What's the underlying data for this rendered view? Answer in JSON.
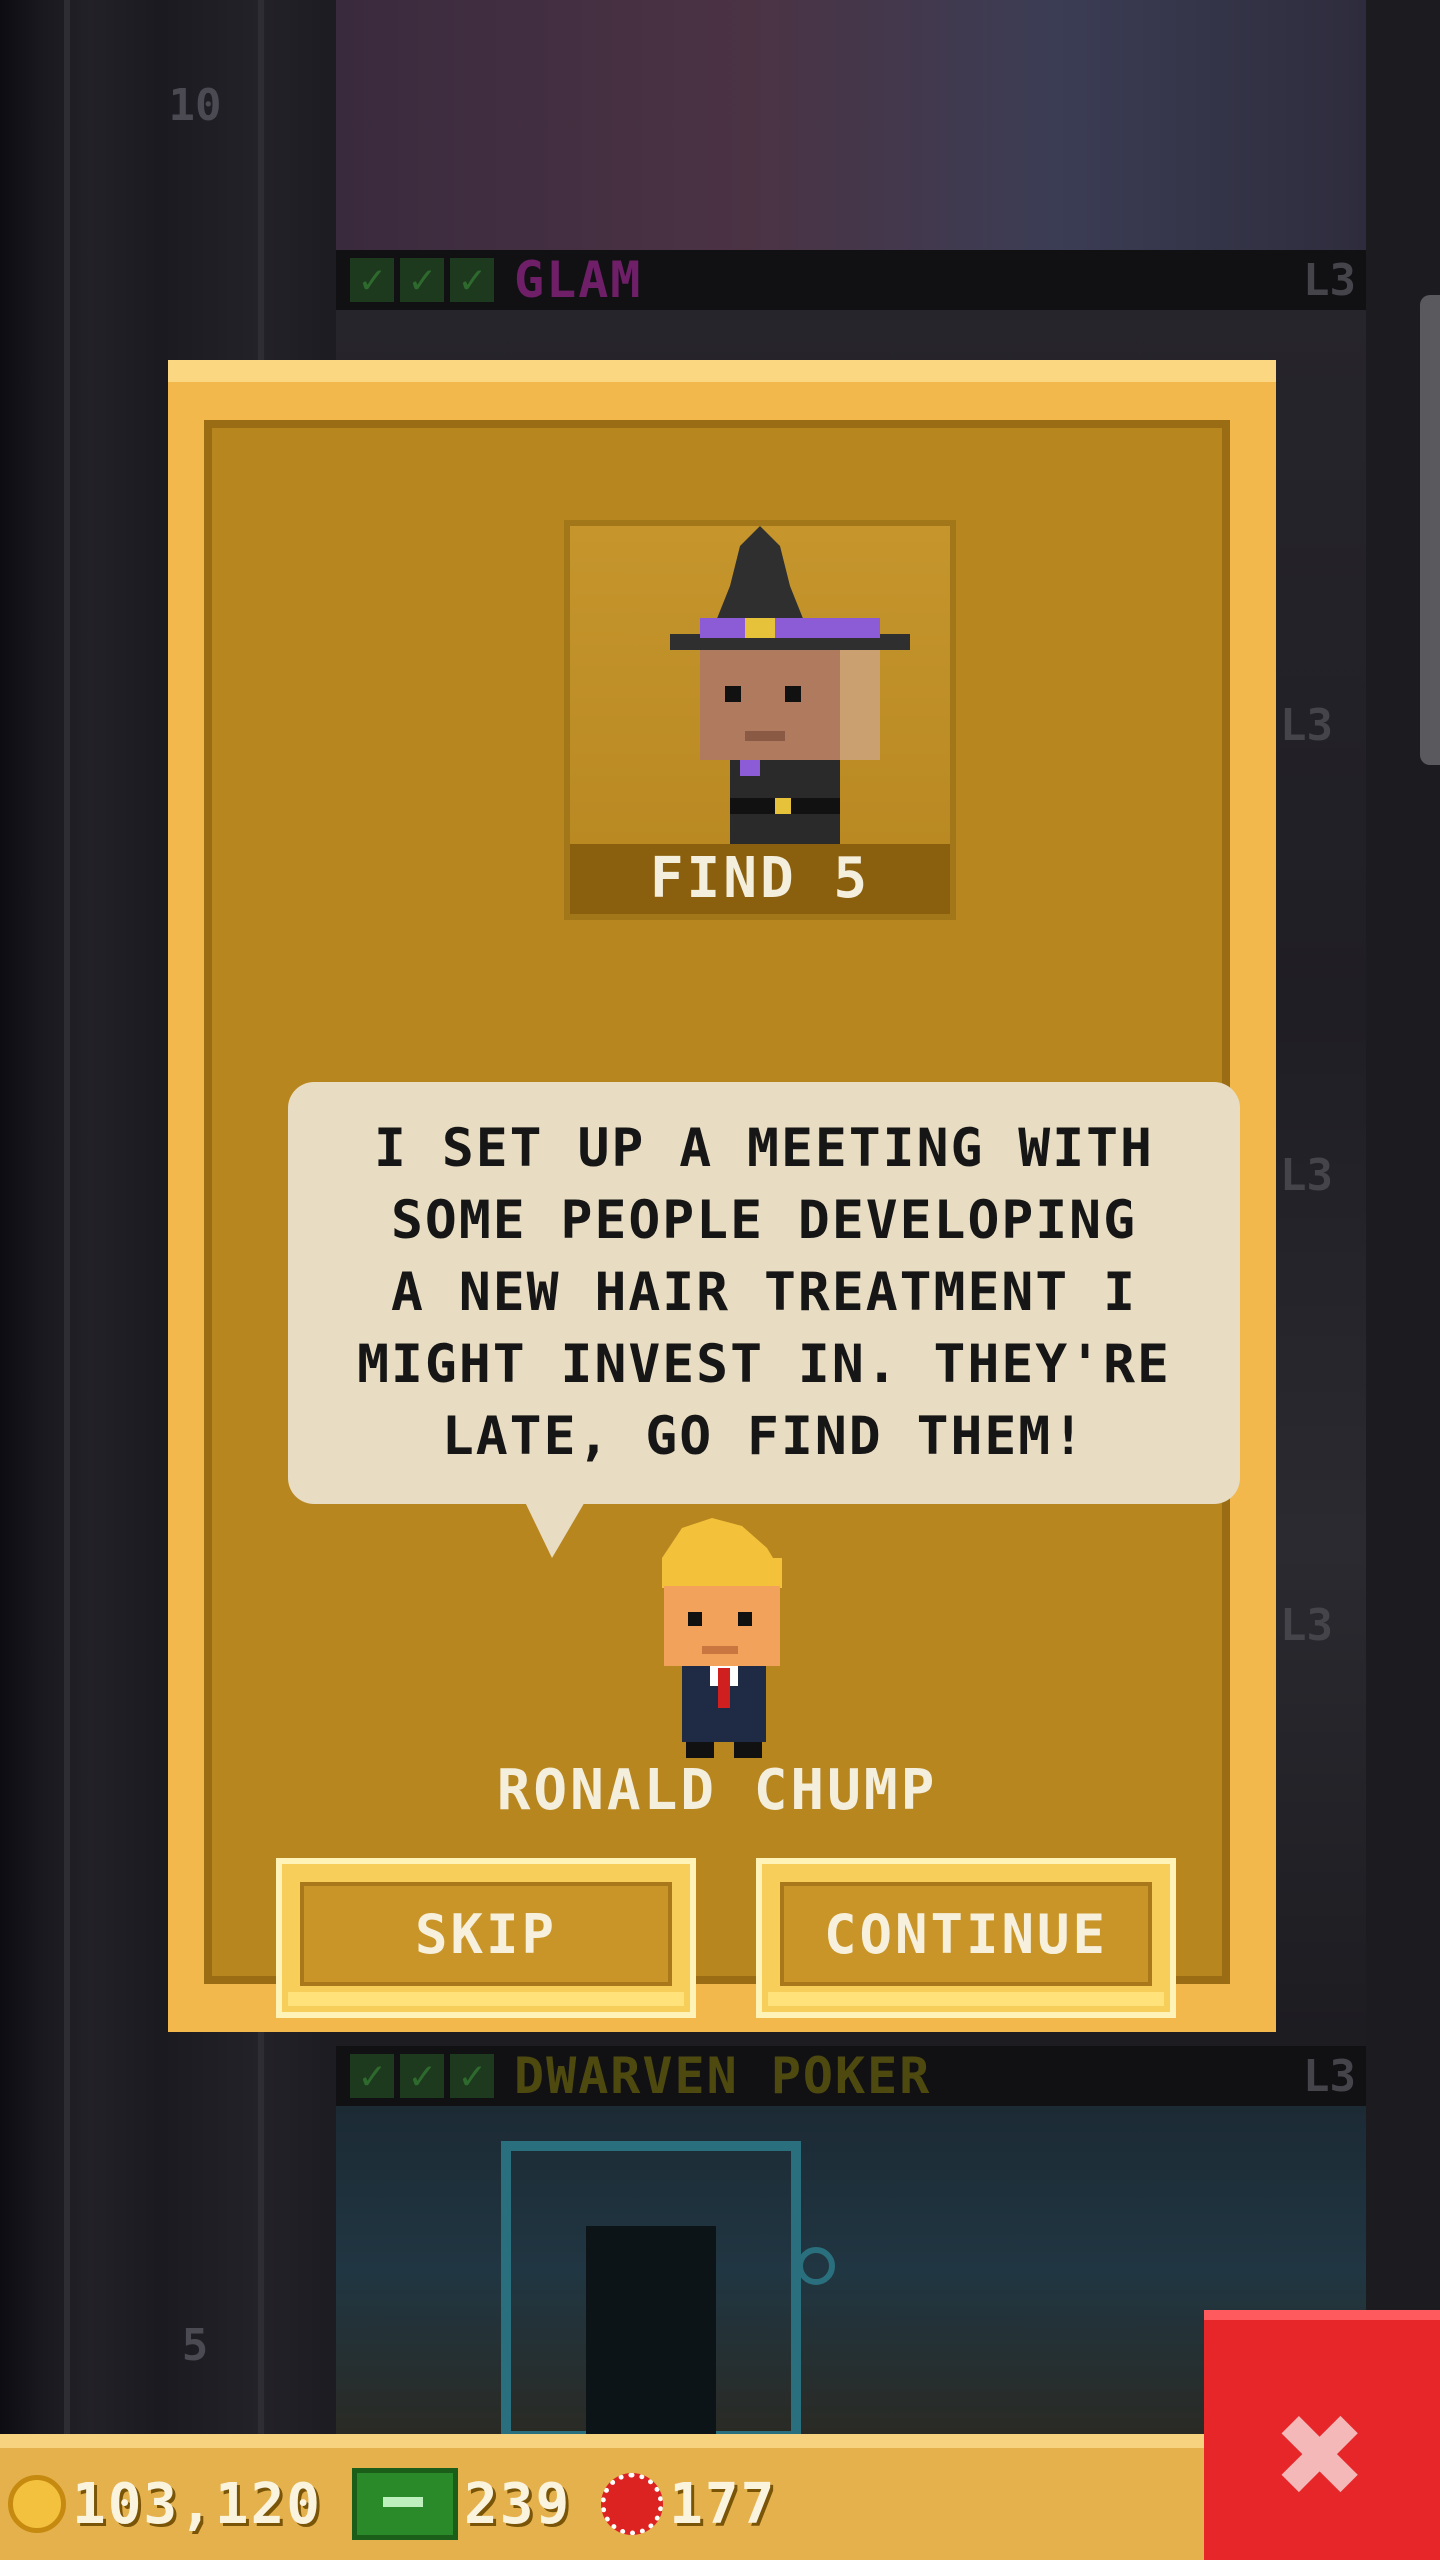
{
  "background": {
    "floor_numbers": [
      "10",
      "5"
    ],
    "rooms": [
      {
        "name": "GLAM",
        "level": "L3",
        "color": "#7a1e74"
      },
      {
        "name": "DWARVEN POKER",
        "level": "L3",
        "color": "#5a5410"
      }
    ],
    "side_levels": [
      "L3",
      "L3",
      "L3",
      "L3"
    ]
  },
  "mission": {
    "find_label": "FIND 5",
    "dialogue_lines": [
      "I SET UP A MEETING WITH",
      "SOME PEOPLE DEVELOPING",
      "A NEW HAIR TREATMENT I",
      "MIGHT INVEST IN. THEY'RE",
      "LATE, GO FIND THEM!"
    ],
    "npc_name": "RONALD CHUMP",
    "skip_label": "SKIP",
    "continue_label": "CONTINUE"
  },
  "currency": {
    "coins": "103,120",
    "bux": "239",
    "chips": "177"
  },
  "colors": {
    "modal_gold": "#f2b84b",
    "modal_inner": "#b8861f",
    "close_red": "#e7262a"
  },
  "icons": [
    "coin-icon",
    "bux-icon",
    "poker-chip-icon",
    "close-icon"
  ]
}
